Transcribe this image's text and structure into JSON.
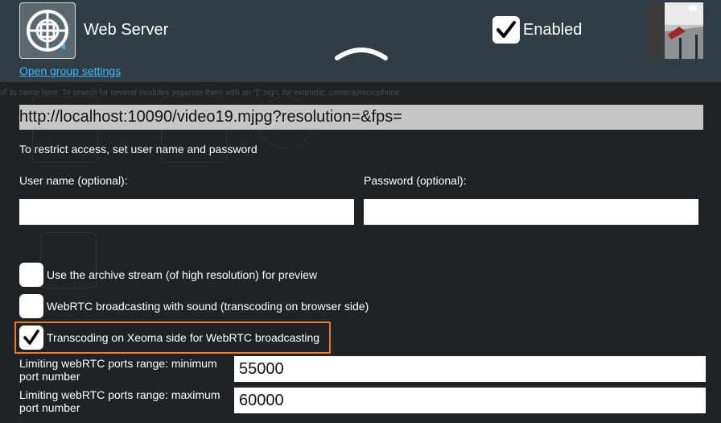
{
  "header": {
    "title": "Web Server",
    "group_link": "Open group settings",
    "enabled_label": "Enabled",
    "enabled_checked": true
  },
  "background_hint": "of its name here. To search for several modules separate them with an \"|\" sign, for example: camera|microphone",
  "stream_url": "http://localhost:10090/video19.mjpg?resolution=&fps=",
  "access_hint": "To restrict access, set user name and password",
  "username": {
    "label": "User name (optional):",
    "value": ""
  },
  "password": {
    "label": "Password (optional):",
    "value": ""
  },
  "options": [
    {
      "label": "Use the archive stream (of high resolution) for preview",
      "checked": false
    },
    {
      "label": "WebRTC broadcasting with sound (transcoding on browser side)",
      "checked": false
    },
    {
      "label": "Transcoding on Xeoma side for WebRTC broadcasting",
      "checked": true
    }
  ],
  "ports": {
    "min_label": "Limiting webRTC ports range: minimum port number",
    "min_value": "55000",
    "max_label": "Limiting webRTC ports range: maximum port number",
    "max_value": "60000"
  },
  "colors": {
    "header_bg": "#313f48",
    "link": "#3fb6ff",
    "highlight": "#e8792e"
  }
}
